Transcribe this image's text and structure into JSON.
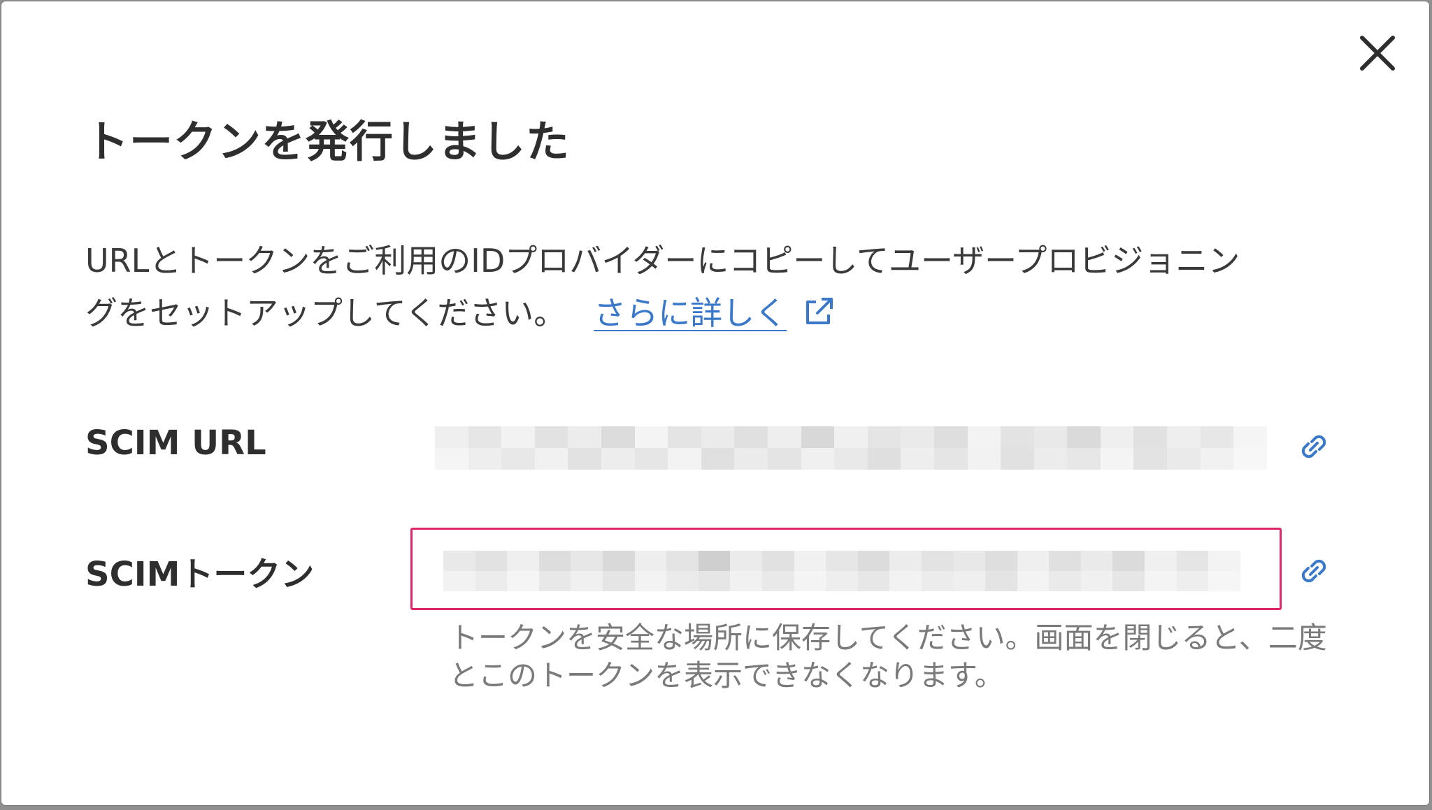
{
  "dialog": {
    "title": "トークンを発行しました",
    "description_line1": "URLとトークンをご利用のIDプロバイダーにコピーしてユーザープロビジョニン",
    "description_line2": "グをセットアップしてください。",
    "learn_more": "さらに詳しく",
    "close_icon": "close-icon",
    "colors": {
      "link": "#3a78c9",
      "highlight_border": "#e0266a",
      "text": "#2e2e2e",
      "help_text": "#7a7a7a"
    }
  },
  "fields": {
    "scim_url": {
      "label": "SCIM URL",
      "copy_icon": "link-icon"
    },
    "scim_token": {
      "label": "SCIMトークン",
      "copy_icon": "link-icon",
      "help_text": "トークンを安全な場所に保存してください。画面を閉じると、二度とこのトークンを表示できなくなります。"
    }
  }
}
